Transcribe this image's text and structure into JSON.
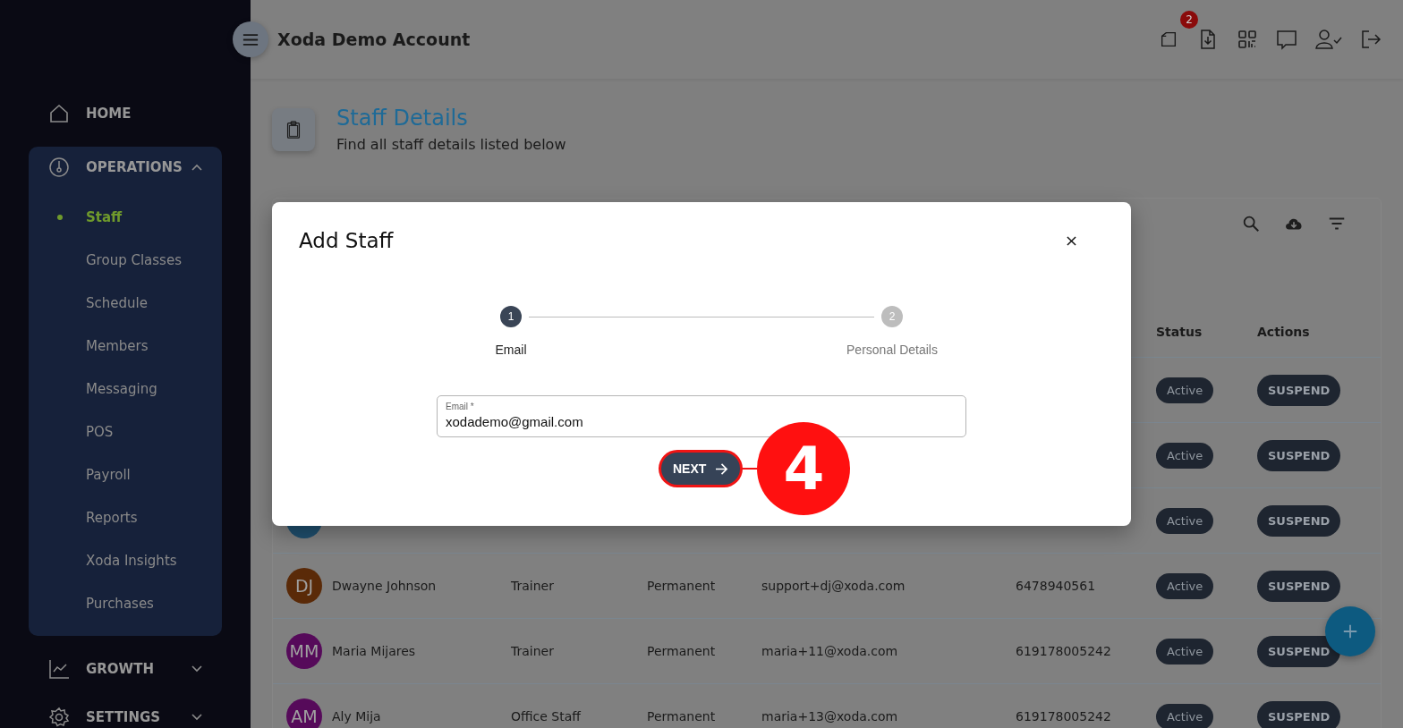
{
  "header": {
    "title": "Xoda Demo Account",
    "notification_count": "2"
  },
  "sidebar": {
    "items": [
      {
        "label": "HOME",
        "kind": "link"
      },
      {
        "label": "OPERATIONS",
        "kind": "group",
        "expanded": true,
        "children": [
          {
            "label": "Staff",
            "selected": true
          },
          {
            "label": "Group Classes",
            "selected": false
          },
          {
            "label": "Schedule",
            "selected": false
          },
          {
            "label": "Members",
            "selected": false
          },
          {
            "label": "Messaging",
            "selected": false
          },
          {
            "label": "POS",
            "selected": false
          },
          {
            "label": "Payroll",
            "selected": false
          },
          {
            "label": "Reports",
            "selected": false
          },
          {
            "label": "Xoda Insights",
            "selected": false
          },
          {
            "label": "Purchases",
            "selected": false
          }
        ]
      },
      {
        "label": "GROWTH",
        "kind": "group",
        "expanded": false
      },
      {
        "label": "SETTINGS",
        "kind": "group",
        "expanded": false
      }
    ]
  },
  "page": {
    "title": "Staff Details",
    "subtitle": "Find all staff details listed below"
  },
  "table": {
    "columns": [
      {
        "label": "Status"
      },
      {
        "label": "Actions"
      }
    ],
    "rows": [
      {
        "status": "Active",
        "action": "SUSPEND"
      },
      {
        "status": "Active",
        "action": "SUSPEND"
      },
      {
        "avatar": {
          "color": "#1f4f6e"
        },
        "status": "Active",
        "action": "SUSPEND"
      },
      {
        "avatar": {
          "initials": "DJ",
          "color": "#5a2a08"
        },
        "name": "Dwayne Johnson",
        "role": "Trainer",
        "type": "Permanent",
        "email": "support+dj@xoda.com",
        "phone": "6478940561",
        "status": "Active",
        "action": "SUSPEND"
      },
      {
        "avatar": {
          "initials": "MM",
          "color": "#560a5a"
        },
        "name": "Maria Mijares",
        "role": "Trainer",
        "type": "Permanent",
        "email": "maria+11@xoda.com",
        "phone": "619178005242",
        "status": "Active",
        "action": "SUSPEND"
      },
      {
        "avatar": {
          "initials": "AM",
          "color": "#560a5a"
        },
        "name": "Aly Mija",
        "role": "Office Staff",
        "type": "Permanent",
        "email": "maria+13@xoda.com",
        "phone": "619178005242",
        "status": "Active",
        "action": "SUSPEND"
      }
    ]
  },
  "modal": {
    "title": "Add Staff",
    "steps": [
      {
        "number": "1",
        "label": "Email",
        "selected": true
      },
      {
        "number": "2",
        "label": "Personal Details",
        "selected": false
      }
    ],
    "email_field": {
      "label": "Email *",
      "value": "xodademo@gmail.com"
    },
    "next_button": {
      "label": "NEXT"
    },
    "annotation": {
      "label": "4"
    }
  }
}
